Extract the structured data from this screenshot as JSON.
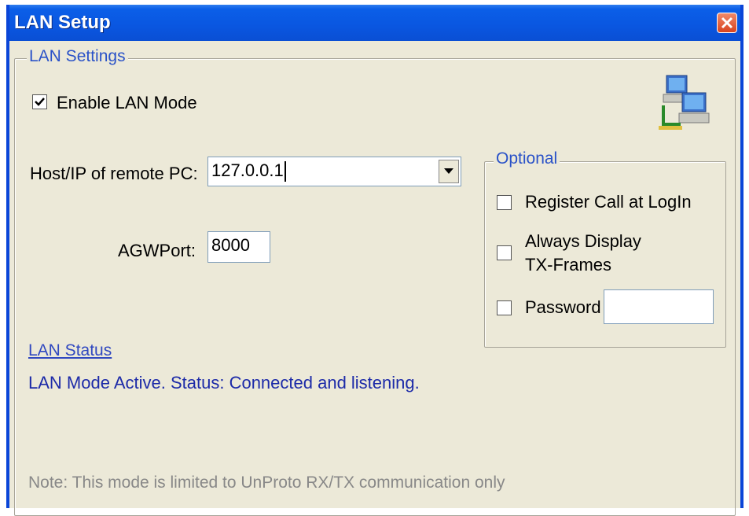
{
  "window": {
    "title": "LAN Setup",
    "close_icon": "close-icon"
  },
  "lan_settings": {
    "group_label": "LAN Settings",
    "enable_lan_mode": {
      "label": "Enable LAN Mode",
      "checked": true
    },
    "host_label": "Host/IP of remote PC:",
    "host_value": "127.0.0.1",
    "agw_port_label": "AGWPort:",
    "agw_port_value": "8000",
    "network_icon": "network-computers-icon"
  },
  "optional": {
    "group_label": "Optional",
    "register_call": {
      "label": "Register Call at LogIn",
      "checked": false
    },
    "always_display": {
      "label_line1": "Always Display",
      "label_line2": "TX-Frames",
      "checked": false
    },
    "password": {
      "label": "Password",
      "checked": false,
      "value": ""
    }
  },
  "lan_status": {
    "link_label": "LAN Status",
    "status_text": "LAN Mode Active. Status: Connected and listening."
  },
  "note": "Note: This mode is limited to UnProto RX/TX communication only"
}
